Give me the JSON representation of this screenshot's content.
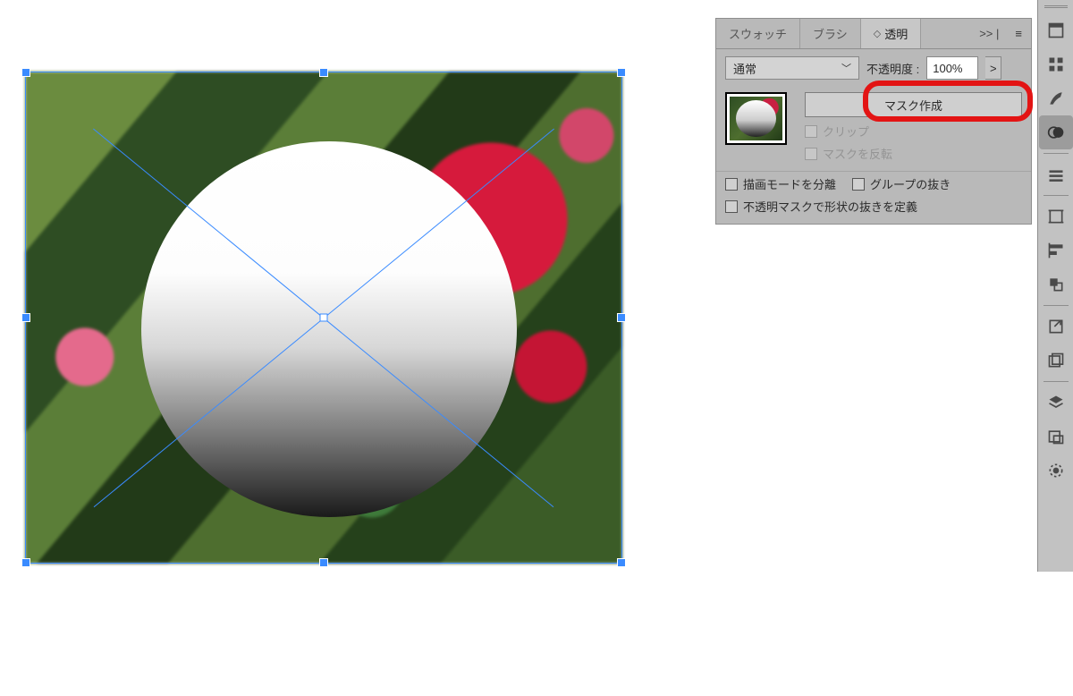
{
  "panel": {
    "tabs": {
      "swatches": "スウォッチ",
      "brushes": "ブラシ",
      "transparency": "透明"
    },
    "collapse_glyph": ">> |",
    "menu_glyph": "≡",
    "blend_mode": "通常",
    "opacity_label": "不透明度 :",
    "opacity_value": "100%",
    "opacity_more_glyph": ">",
    "make_mask": "マスク作成",
    "clip": "クリップ",
    "invert_mask": "マスクを反転",
    "isolate_blending": "描画モードを分離",
    "knockout_group": "グループの抜き",
    "opacity_mask_define": "不透明マスクで形状の抜きを定義"
  },
  "dock": {
    "icons": [
      "properties-icon",
      "swatches-icon",
      "brushes-icon",
      "transparency-icon",
      "stroke-icon",
      "artboards-icon",
      "align-icon",
      "transform-icon",
      "export-icon",
      "libraries-icon",
      "layers-icon",
      "asset-export-icon",
      "appearance-icon"
    ]
  }
}
